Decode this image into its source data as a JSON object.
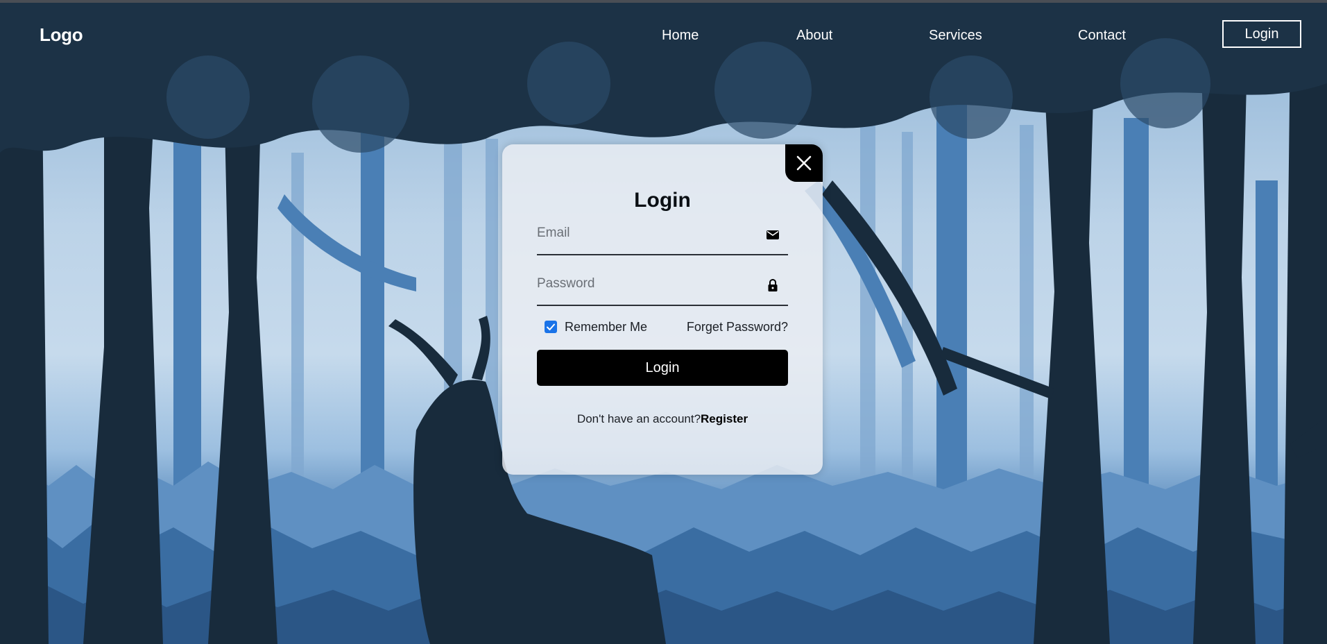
{
  "nav": {
    "logo": "Logo",
    "links": [
      "Home",
      "About",
      "Services",
      "Contact"
    ],
    "login_button": "Login"
  },
  "login_form": {
    "title": "Login",
    "email_placeholder": "Email",
    "email_icon": "envelope-icon",
    "password_placeholder": "Password",
    "password_icon": "lock-icon",
    "remember_label": "Remember Me",
    "remember_checked": true,
    "forget_password": "Forget Password?",
    "submit_label": "Login",
    "register_prompt": "Don't have an account?",
    "register_link": "Register",
    "close_icon": "close-icon"
  },
  "colors": {
    "dark_navy": "#172a3a",
    "mid_blue": "#3e6fa3",
    "light_blue": "#c6daec",
    "accent_checkbox": "#1a73e8",
    "button_black": "#000000"
  }
}
